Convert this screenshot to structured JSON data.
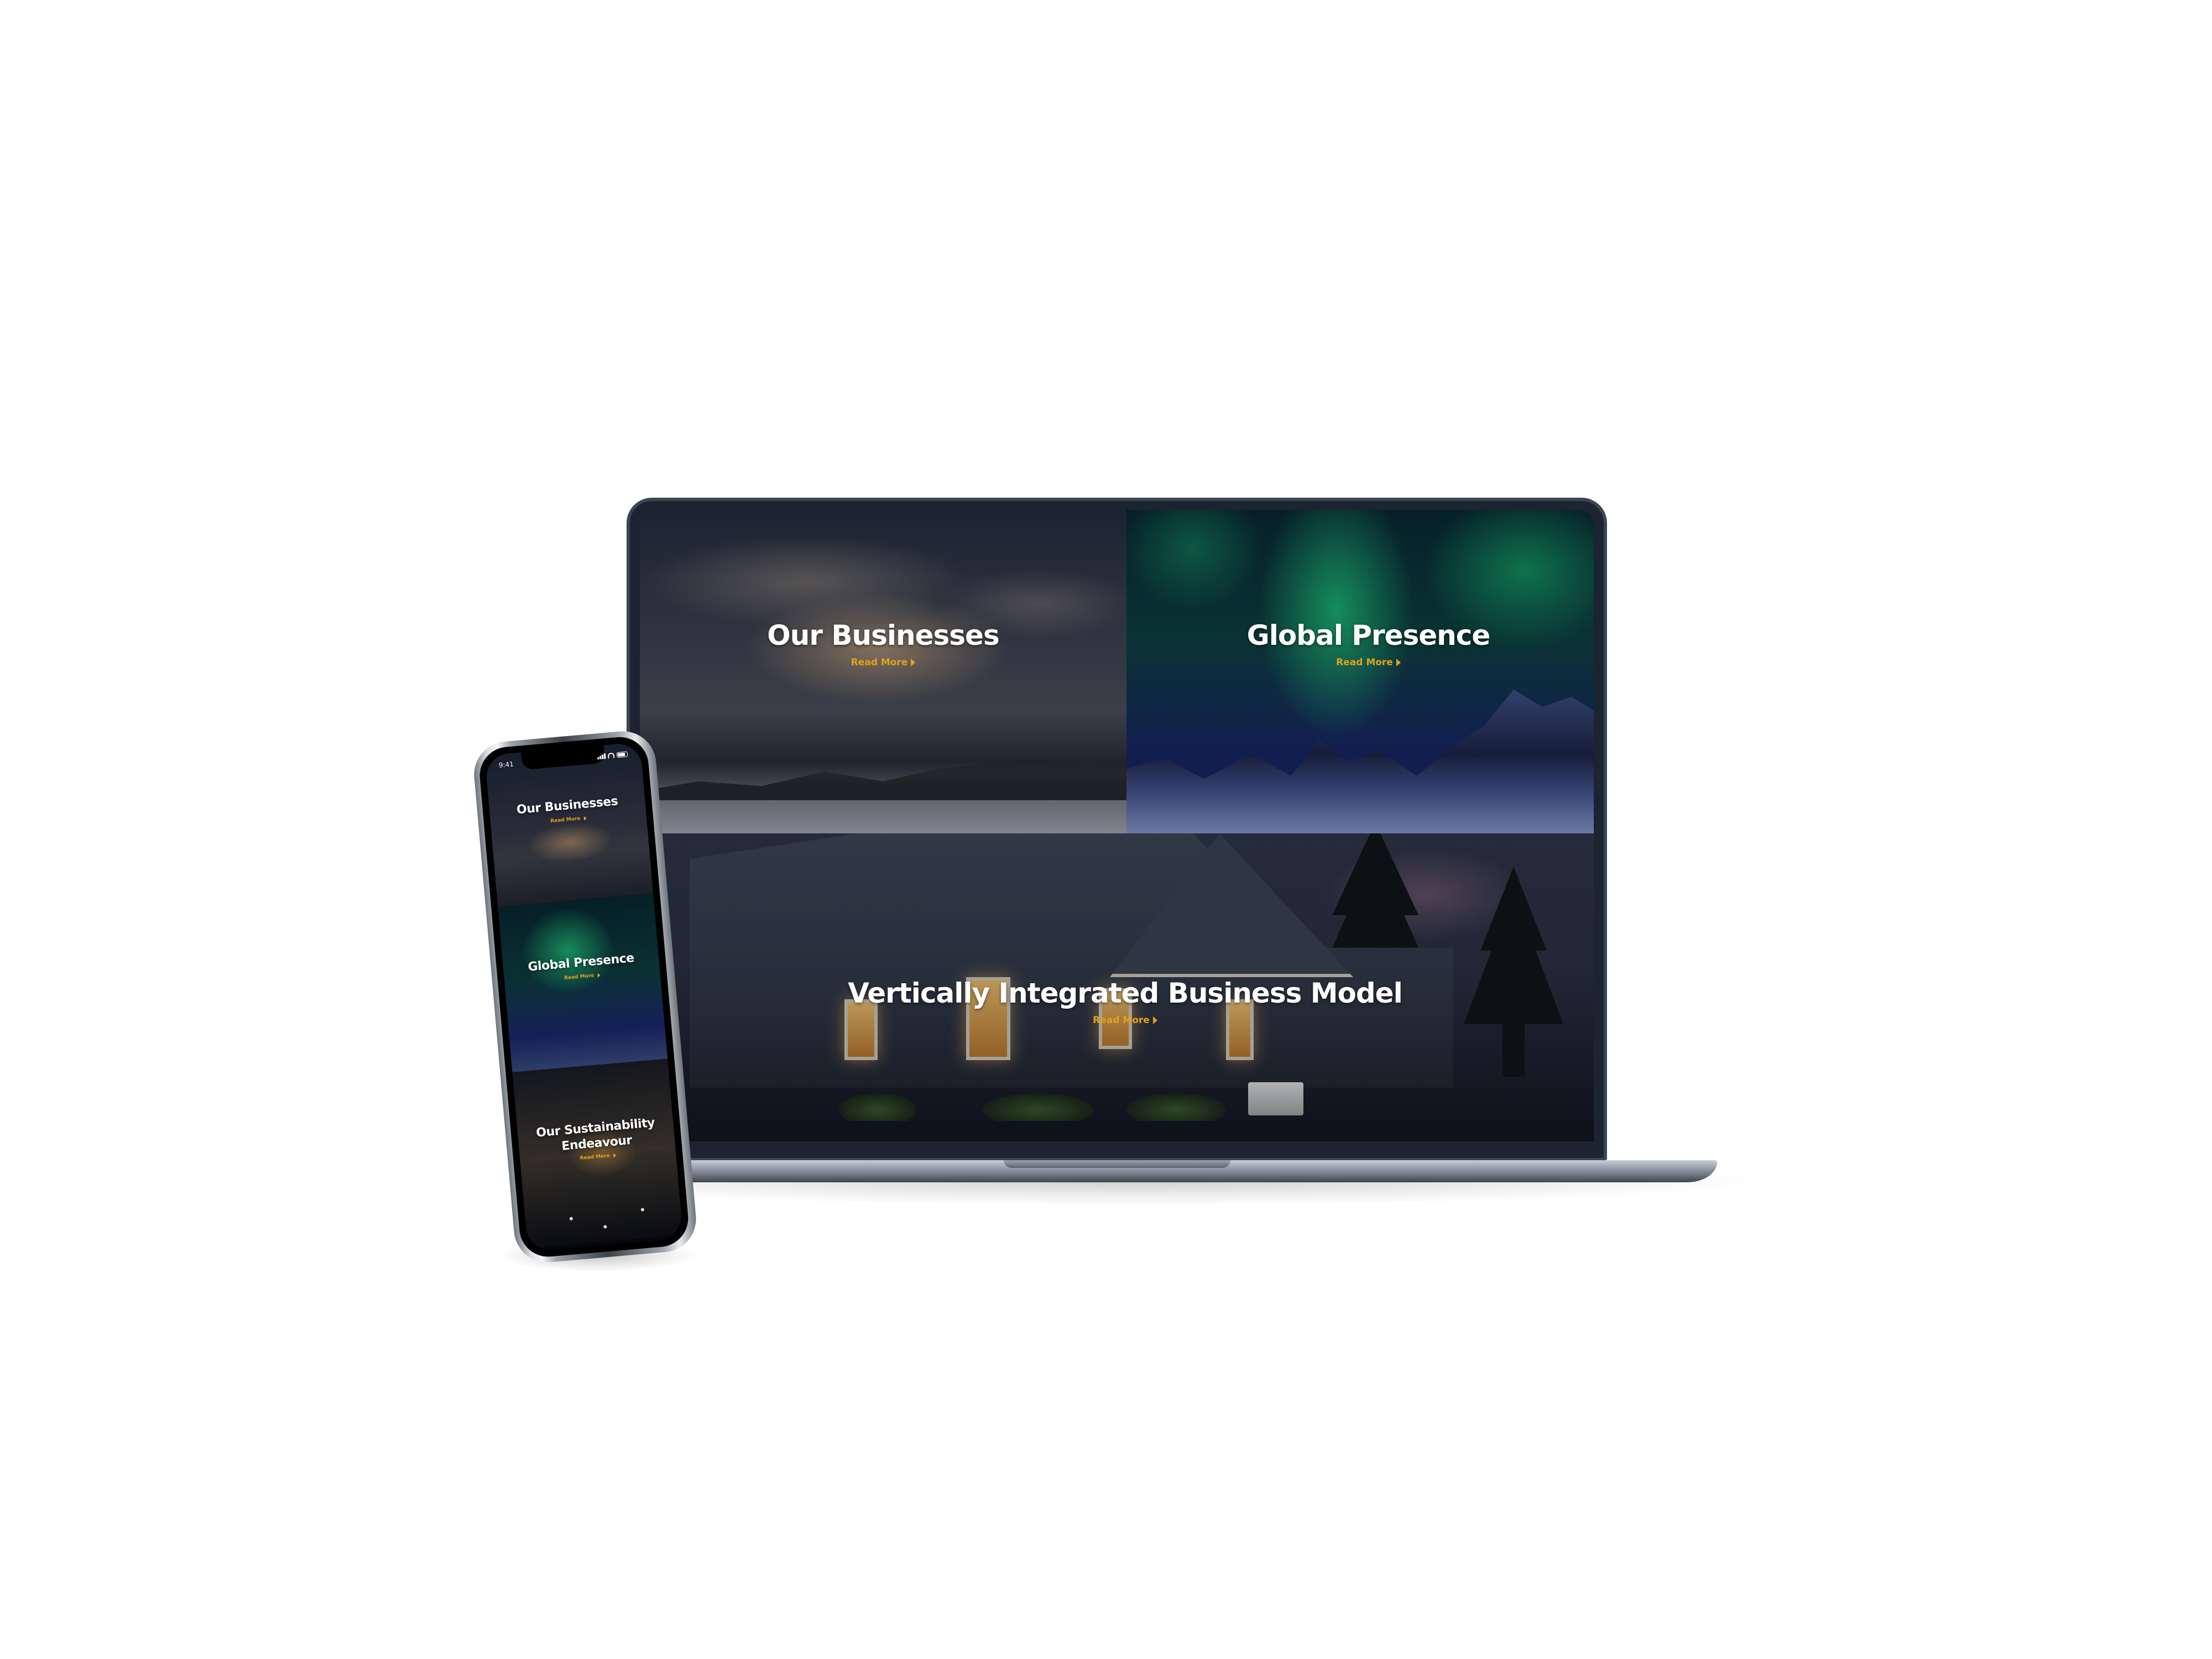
{
  "laptop": {
    "tiles": [
      {
        "title": "Our Businesses",
        "link": "Read More"
      },
      {
        "title": "Global Presence",
        "link": "Read More"
      },
      {
        "title": "Vertically Integrated Business Model",
        "link": "Read More"
      }
    ]
  },
  "phone": {
    "status_time": "9:41",
    "tiles": [
      {
        "title": "Our Businesses",
        "link": "Read More"
      },
      {
        "title": "Global Presence",
        "link": "Read More"
      },
      {
        "title_line1": "Our Sustainability",
        "title_line2": "Endeavour",
        "link": "Read More"
      }
    ]
  },
  "colors": {
    "accent": "#e3a21a",
    "heading": "#ffffff"
  },
  "icons": [
    "chevron-right-icon",
    "signal-icon",
    "wifi-icon",
    "battery-icon"
  ]
}
